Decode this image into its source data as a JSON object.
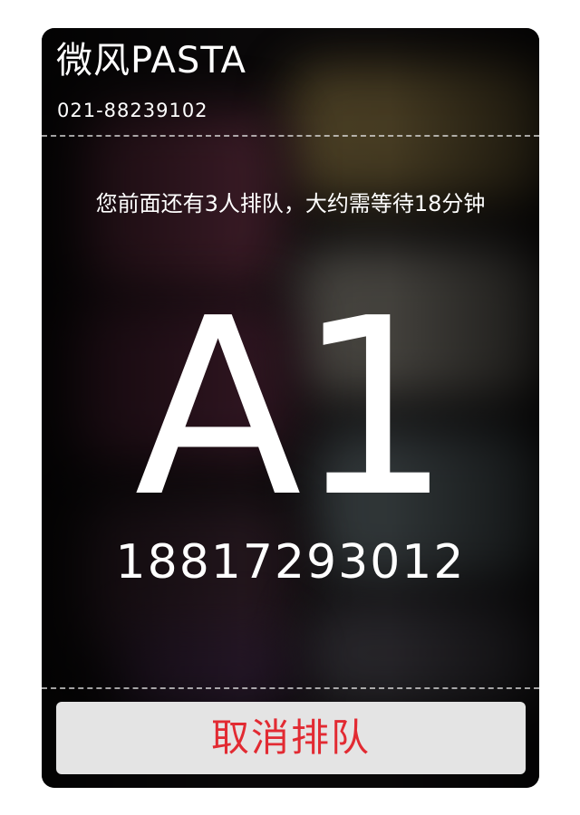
{
  "header": {
    "title": "微风PASTA",
    "phone": "021-88239102"
  },
  "queue": {
    "wait_message": "您前面还有3人排队，大约需等待18分钟",
    "number": "A1",
    "customer_phone": "18817293012"
  },
  "actions": {
    "cancel_label": "取消排队"
  },
  "colors": {
    "card_background": "#0c0a0b",
    "text": "#ffffff",
    "button_background": "#e4e4e4",
    "button_text": "#e22a32"
  }
}
